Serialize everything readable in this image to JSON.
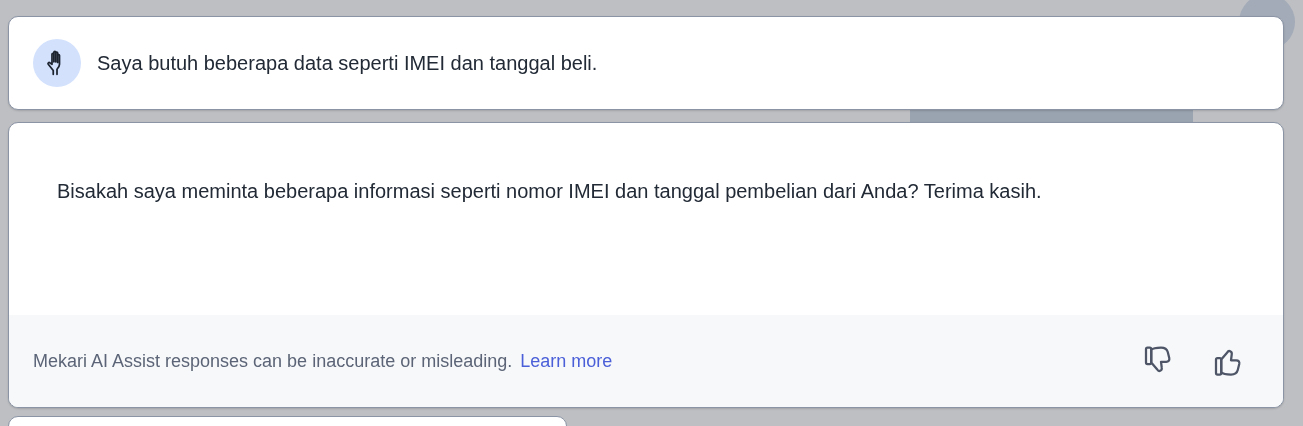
{
  "prompt": {
    "text": "Saya butuh beberapa data seperti IMEI dan tanggal beli."
  },
  "response": {
    "text": "Bisakah saya meminta beberapa informasi seperti nomor IMEI dan tanggal pembelian dari Anda? Terima kasih.",
    "disclaimer": "Mekari AI Assist responses can be inaccurate or misleading.",
    "link": "Learn more"
  }
}
